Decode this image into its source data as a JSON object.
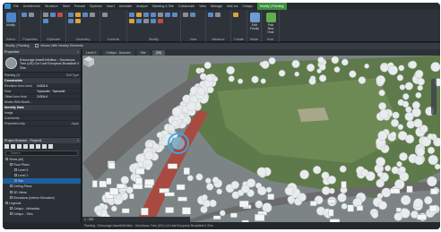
{
  "ribbon": {
    "tabs": [
      "File",
      "Architecture",
      "Structure",
      "Steel",
      "Precast",
      "Systems",
      "Insert",
      "Annotate",
      "Analyze",
      "Massing & Site",
      "Collaborate",
      "View",
      "Manage",
      "Add-Ins",
      "Cetapo",
      "Modify | Planting"
    ],
    "active_tab": "Modify | Planting",
    "panels": [
      "Select",
      "Properties",
      "Clipboard",
      "Geometry",
      "Controls",
      "Modify",
      "View",
      "Measure",
      "Create",
      "Mode",
      "Host"
    ],
    "buttons": {
      "modify": "Modify",
      "edit_family": "Edit Family",
      "pick_new_host": "Pick New Host"
    }
  },
  "context_bar": {
    "title": "Modify | Planting",
    "checkbox_label": "Moves With Nearby Elements"
  },
  "properties": {
    "header": "Properties",
    "type_name": "Entourage AssetDefinition - Deciduous Tree (US) Cut Leaf European Broadleaf 4 20m",
    "family_selector": "Planting (1)",
    "edit_type": "Edit Type",
    "section": "Constraints",
    "rows": [
      {
        "label": "Elevation from Level",
        "value": "24304.6"
      },
      {
        "label": "Host",
        "value": "Toposolid : Toposolid"
      },
      {
        "label": "Offset from Host",
        "value": "24304.6"
      },
      {
        "label": "Moves With Nearb...",
        "value": ""
      }
    ],
    "section2": "Identity Data",
    "rows2": [
      {
        "label": "Image",
        "value": ""
      },
      {
        "label": "Comments",
        "value": ""
      }
    ],
    "help": "Properties help",
    "apply": "Apply"
  },
  "browser": {
    "header": "Project Browser - Project1",
    "search_placeholder": "Search",
    "tree": [
      {
        "label": "Views (all)",
        "indent": 0
      },
      {
        "label": "Floor Plans",
        "indent": 1
      },
      {
        "label": "Level 0",
        "indent": 2
      },
      {
        "label": "Level 1",
        "indent": 2
      },
      {
        "label": "Site",
        "indent": 2
      },
      {
        "label": "Ceiling Plans",
        "indent": 1
      },
      {
        "label": "3D Views",
        "indent": 1
      },
      {
        "label": "Elevations (Interior Elevation)",
        "indent": 1
      },
      {
        "label": "Legends",
        "indent": 0
      },
      {
        "label": "Cetapo - Metadata",
        "indent": 1
      },
      {
        "label": "Cetapo - Tiles",
        "indent": 1
      }
    ]
  },
  "view_tabs": [
    "Level 0",
    "Cetapo - Sources",
    "Site",
    "{3D}"
  ],
  "active_view_tab": "{3D}",
  "view_controls": {
    "scale": "1 : 200"
  },
  "status_text": "Planting : Entourage AssetDefinition : Deciduous Tree (US) Cut Leaf European Broadleaf 4 20m",
  "colors": {
    "active_tab": "#3f8f3f",
    "selection": "#38a8e8",
    "ribbon": "#2d3339"
  }
}
